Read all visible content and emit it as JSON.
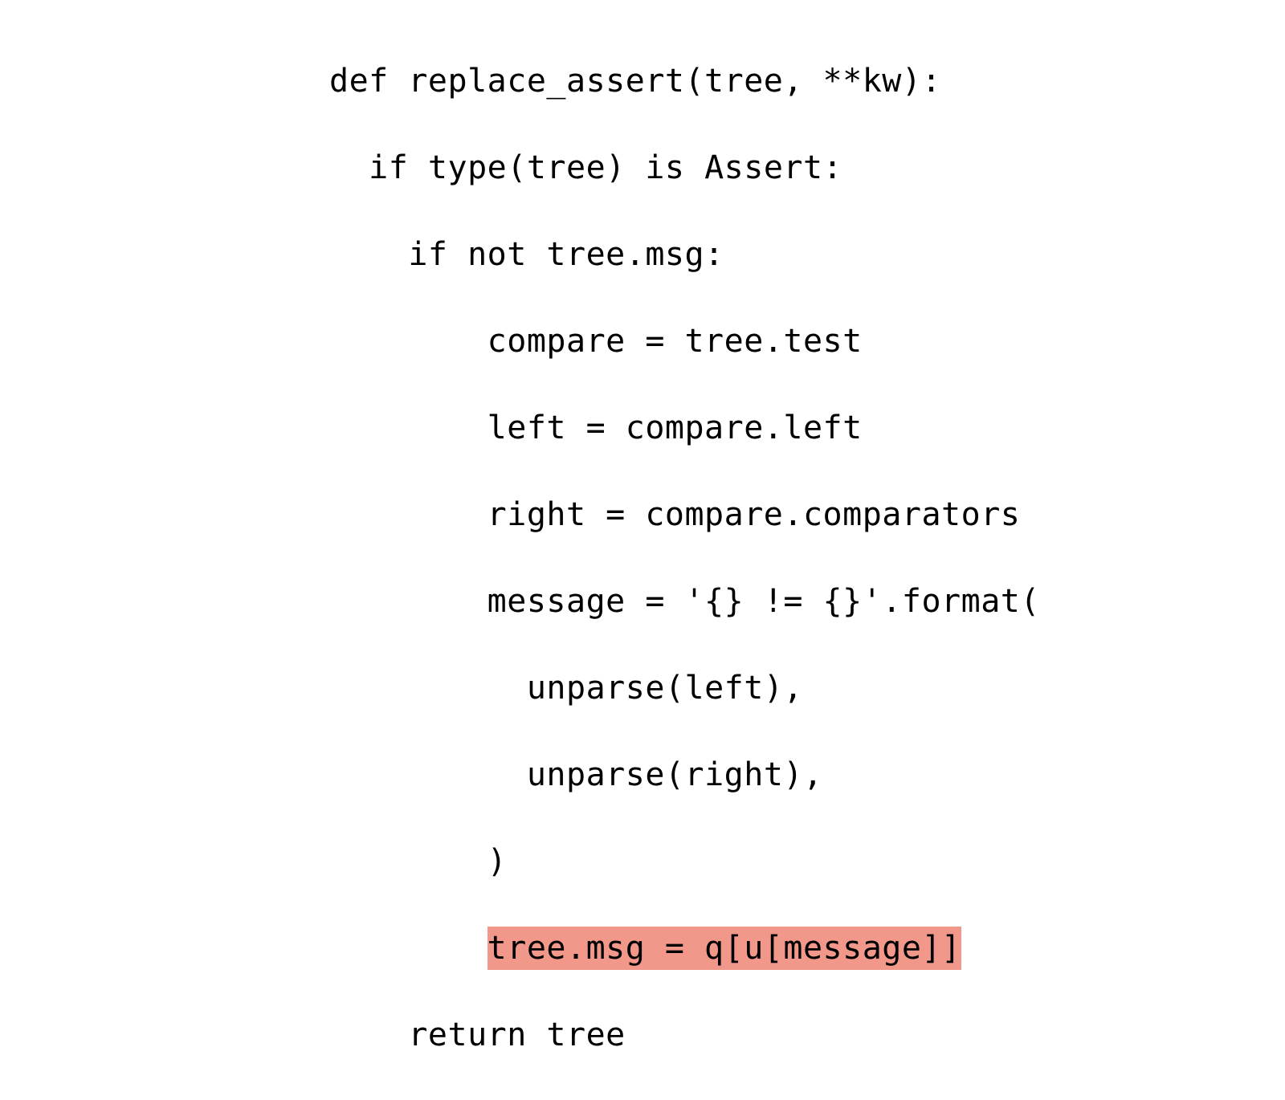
{
  "code": {
    "indent1": "  ",
    "indent2": "    ",
    "indent3": "        ",
    "indent4": "          ",
    "line1": "def replace_assert(tree, **kw):",
    "line2": "if type(tree) is Assert:",
    "line3": "if not tree.msg:",
    "line4": "compare = tree.test",
    "line5": "left = compare.left",
    "line6": "right = compare.comparators",
    "line7": "message = '{} != {}'.format(",
    "line8": "unparse(left),",
    "line9": "unparse(right),",
    "line10": ")",
    "line11_hl": "tree.msg = q[u[message]]",
    "line12": "return tree"
  },
  "highlight_color": "#f2988a"
}
